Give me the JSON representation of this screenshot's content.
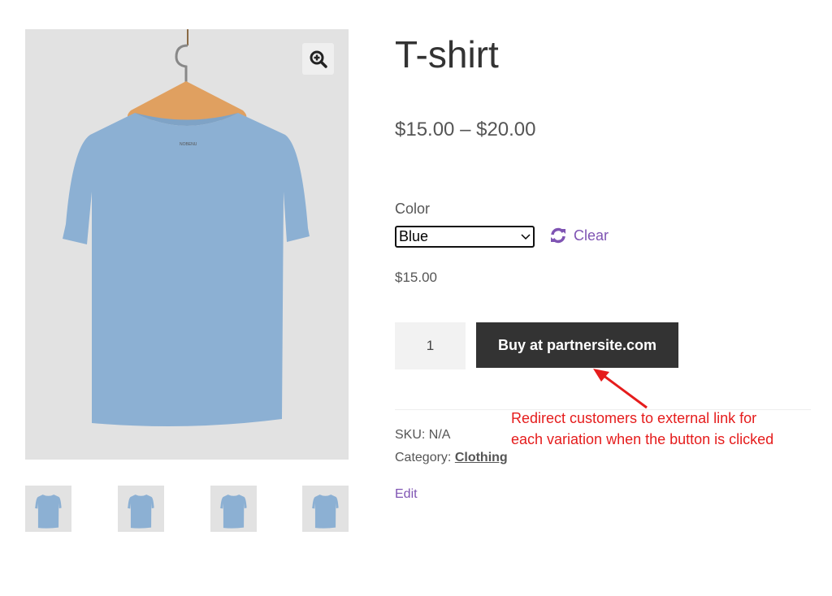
{
  "product": {
    "title": "T-shirt",
    "price_range": "$15.00 – $20.00",
    "attribute_label": "Color",
    "selected_color": "Blue",
    "clear_label": "Clear",
    "variation_price": "$15.00",
    "quantity": "1",
    "buy_label": "Buy at partnersite.com",
    "sku_label": "SKU:",
    "sku_value": "N/A",
    "category_label": "Category:",
    "category_value": "Clothing",
    "edit_label": "Edit",
    "shirt_brand": "NOBENU"
  },
  "gallery": {
    "main_color": "#8cb0d3",
    "thumbnails": [
      {
        "color": "#c9dcec"
      },
      {
        "color": "#f2dc9f"
      },
      {
        "color": "#d88193"
      },
      {
        "color": "#7fa2c8"
      }
    ]
  },
  "annotation": {
    "line1": "Redirect customers to external link for",
    "line2": "each variation when the button is clicked",
    "color": "#e51c1c"
  },
  "colors": {
    "accent": "#7f54b3",
    "button": "#333333"
  }
}
